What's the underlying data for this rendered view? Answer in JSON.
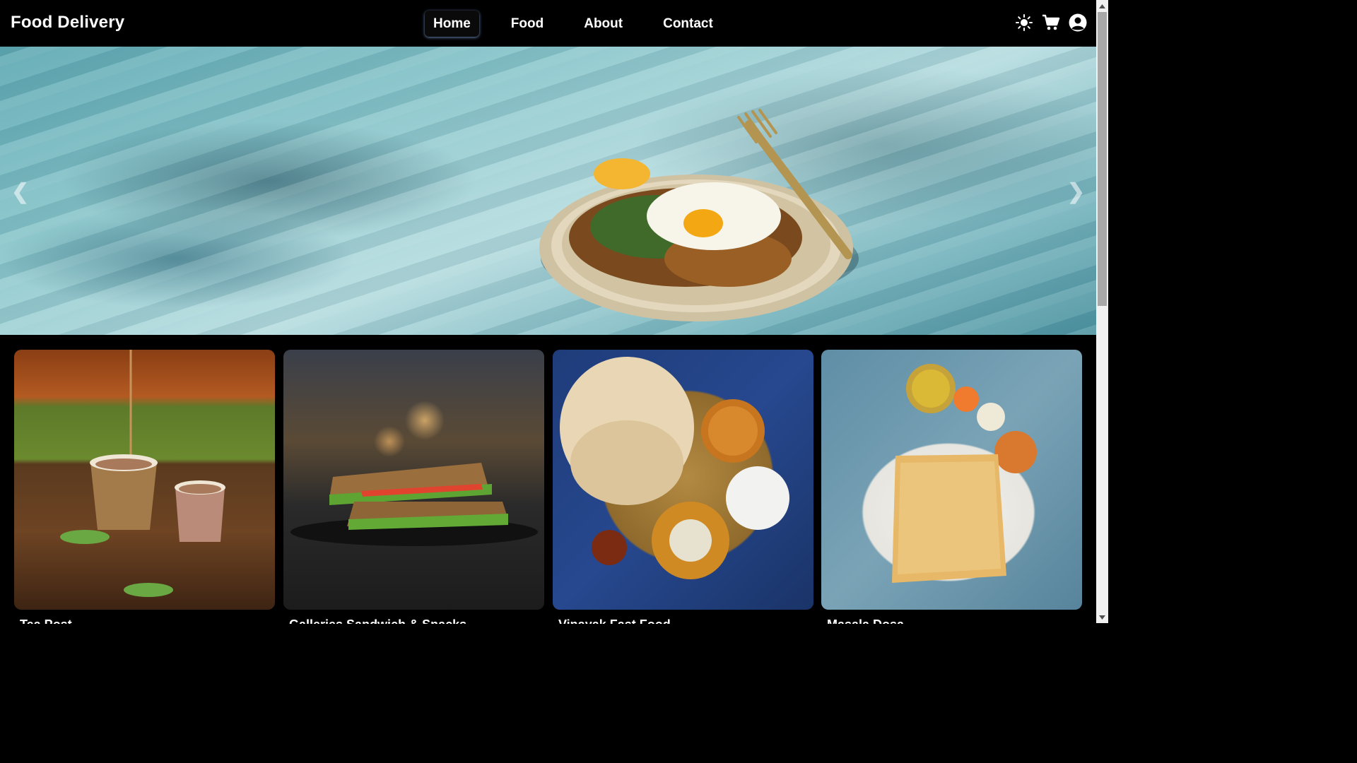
{
  "brand": "Food Delivery",
  "nav": {
    "links": [
      "Home",
      "Food",
      "About",
      "Contact"
    ],
    "active": "Home",
    "icons": [
      "sun-icon",
      "cart-icon",
      "user-icon"
    ]
  },
  "carousel": {
    "prev": "❮",
    "next": "❯",
    "slide": "plate-of-noodles-with-fried-egg"
  },
  "cards": [
    {
      "label": "Tea Post",
      "image": "tea-cups"
    },
    {
      "label": "Galleries Sandwich & Snacks",
      "image": "sandwich"
    },
    {
      "label": "Vinayak Fast Food",
      "image": "thali-naan-curry"
    },
    {
      "label": "Masala Dosa",
      "image": "dosa-platter"
    }
  ],
  "colors": {
    "background": "#000000",
    "text": "#ffffff",
    "active_glow": "#7896c8"
  }
}
